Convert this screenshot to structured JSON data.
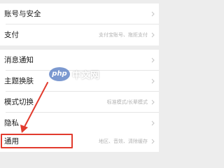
{
  "settings": {
    "rows": [
      {
        "label": "账号与安全",
        "value": ""
      },
      {
        "label": "支付",
        "value": "支付宝账号、拖拒支付"
      },
      {
        "label": "消息通知",
        "value": ""
      },
      {
        "label": "主题换肤",
        "value": ""
      },
      {
        "label": "模式切换",
        "value": "标准模式/长辈模式"
      },
      {
        "label": "隐私",
        "value": ""
      },
      {
        "label": "通用",
        "value": "地区、音效、清除缓存"
      }
    ]
  },
  "watermark": {
    "badge": "php",
    "text": "中文网"
  },
  "colors": {
    "highlight": "#e23b2e",
    "background": "#ededed"
  }
}
